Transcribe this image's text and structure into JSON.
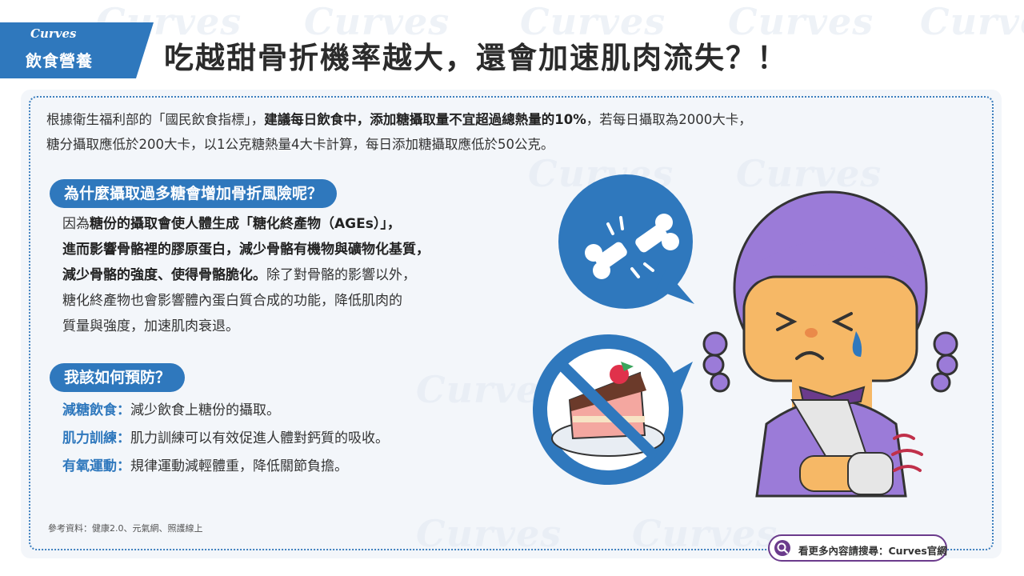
{
  "watermark": "Curves",
  "header": {
    "brand": "Curves",
    "category": "飲食營養",
    "title": "吃越甜骨折機率越大，還會加速肌肉流失？！"
  },
  "intro": {
    "part1": "根據衛生福利部的「國民飲食指標」，",
    "bold": "建議每日飲食中，添加糖攝取量不宜超過總熱量的10%",
    "part2": "，若每日攝取為2000大卡，",
    "line2": "糖分攝取應低於200大卡，以1公克糖熱量4大卡計算，每日添加糖攝取應低於50公克。"
  },
  "section1": {
    "heading": "為什麼攝取過多糖會增加骨折風險呢？",
    "line1_pre": "因為",
    "line1_bold": "糖份的攝取會使人體生成「糖化終產物（AGEs）」，",
    "line2_bold": "進而影響骨骼裡的膠原蛋白，減少骨骼有機物與礦物化基質，",
    "line3_bold": "減少骨骼的強度、使得骨骼脆化。",
    "line3_rest": "除了對骨骼的影響以外，",
    "line4": "糖化終產物也會影響體內蛋白質合成的功能，降低肌肉的",
    "line5": "質量與強度，加速肌肉衰退。"
  },
  "section2": {
    "heading": "我該如何預防？",
    "tips": [
      {
        "label": "減糖飲食：",
        "text": "減少飲食上糖份的攝取。"
      },
      {
        "label": "肌力訓練：",
        "text": "肌力訓練可以有效促進人體對鈣質的吸收。"
      },
      {
        "label": "有氧運動：",
        "text": "規律運動減輕體重，降低關節負擔。"
      }
    ]
  },
  "reference": "參考資料：健康2.0、元氣網、照護線上",
  "search": {
    "label": "看更多內容請搜尋：Curves官網",
    "icon": "search-icon"
  },
  "colors": {
    "primary_blue": "#2f78bd",
    "purple": "#6b3b8c",
    "hair": "#9b7bd8"
  }
}
